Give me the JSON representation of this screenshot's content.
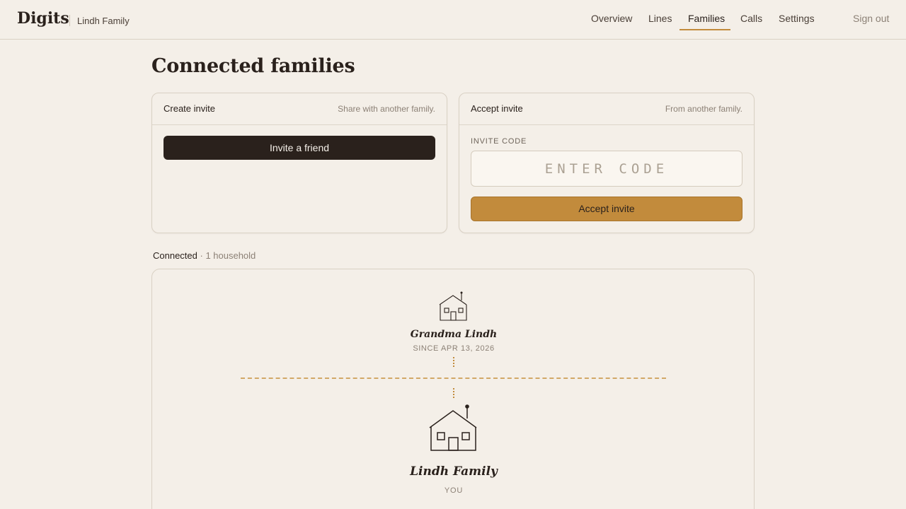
{
  "header": {
    "brand": "Digits",
    "family_name": "Lindh Family",
    "nav": [
      "Overview",
      "Lines",
      "Families",
      "Calls",
      "Settings"
    ],
    "active_nav": "Families",
    "sign_out": "Sign out"
  },
  "page": {
    "title": "Connected families"
  },
  "create_invite": {
    "title": "Create invite",
    "hint": "Share with another family.",
    "button": "Invite a friend"
  },
  "accept_invite": {
    "title": "Accept invite",
    "hint": "From another family.",
    "code_label": "INVITE CODE",
    "code_placeholder": "ENTER CODE",
    "code_value": "",
    "button": "Accept invite"
  },
  "connected": {
    "label": "Connected",
    "count_text": " · 1 household",
    "households": [
      {
        "name": "Grandma Lindh",
        "since": "SINCE APR 13, 2026",
        "icon": "house-icon"
      }
    ],
    "self": {
      "name": "Lindh Family",
      "tag": "YOU",
      "icon": "house-icon"
    }
  },
  "colors": {
    "background": "#f4efe8",
    "text": "#2a211c",
    "accent": "#c28b3c",
    "muted": "#8c8176",
    "dark_button": "#2a211c"
  }
}
